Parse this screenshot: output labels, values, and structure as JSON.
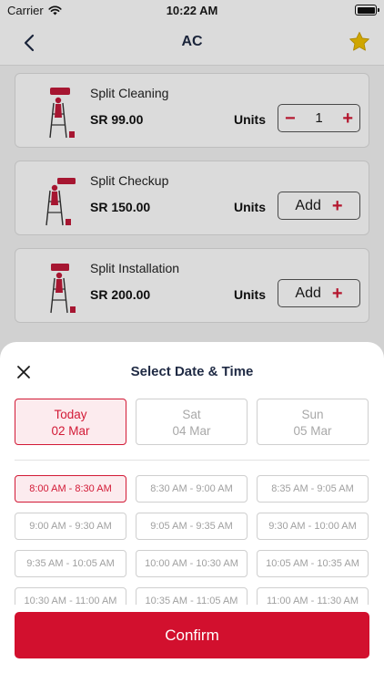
{
  "status_bar": {
    "carrier": "Carrier",
    "time": "10:22 AM"
  },
  "header": {
    "title": "AC",
    "back_icon": "chevron-left-icon",
    "favorite_icon": "star-icon",
    "favorite_color": "#f2c200"
  },
  "services": [
    {
      "name": "Split Cleaning",
      "price": "SR 99.00",
      "units_label": "Units",
      "quantity": "1",
      "has_stepper": true
    },
    {
      "name": "Split Checkup",
      "price": "SR 150.00",
      "units_label": "Units",
      "add_label": "Add",
      "has_stepper": false
    },
    {
      "name": "Split Installation",
      "price": "SR 200.00",
      "units_label": "Units",
      "add_label": "Add",
      "has_stepper": false
    }
  ],
  "sheet": {
    "title": "Select Date & Time",
    "dates": [
      {
        "day": "Today",
        "date": "02 Mar",
        "selected": true
      },
      {
        "day": "Sat",
        "date": "04 Mar",
        "selected": false
      },
      {
        "day": "Sun",
        "date": "05 Mar",
        "selected": false
      }
    ],
    "time_slots": [
      "8:00 AM - 8:30 AM",
      "8:30 AM - 9:00 AM",
      "8:35 AM - 9:05 AM",
      "9:00 AM - 9:30 AM",
      "9:05 AM - 9:35 AM",
      "9:30 AM - 10:00 AM",
      "9:35 AM - 10:05 AM",
      "10:00 AM - 10:30 AM",
      "10:05 AM - 10:35 AM",
      "10:30 AM - 11:00 AM",
      "10:35 AM - 11:05 AM",
      "11:00 AM - 11:30 AM"
    ],
    "selected_slot": "8:00 AM - 8:30 AM",
    "confirm_label": "Confirm"
  },
  "colors": {
    "accent": "#d2102e",
    "accent_light": "#fcebee"
  }
}
